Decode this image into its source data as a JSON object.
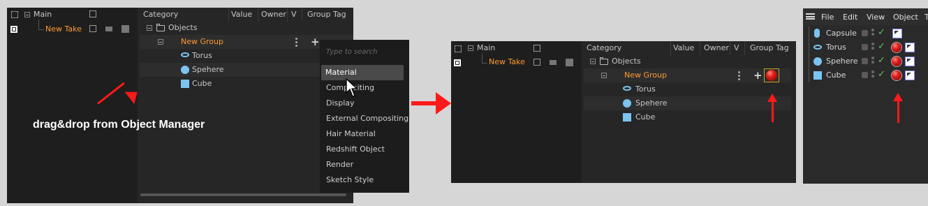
{
  "panel1": {
    "takes": {
      "main": "Main",
      "new_take": "New Take"
    },
    "headers": {
      "category": "Category",
      "value": "Value",
      "owner": "Owner",
      "v": "V",
      "group_tag": "Group Tag"
    },
    "tree": {
      "objects": "Objects",
      "new_group": "New Group",
      "torus": "Torus",
      "sphere": "Spehere",
      "cube": "Cube"
    },
    "annotation": "drag&drop from Object Manager",
    "dropdown": {
      "placeholder": "Type to search",
      "items": [
        "Material",
        "Compositing",
        "Display",
        "External Compositing",
        "Hair Material",
        "Redshift Object",
        "Render",
        "Sketch Style"
      ],
      "selected": "Material"
    }
  },
  "panel2": {
    "takes": {
      "main": "Main",
      "new_take": "New Take"
    },
    "headers": {
      "category": "Category",
      "value": "Value",
      "owner": "Owner",
      "v": "V",
      "group_tag": "Group Tag"
    },
    "tree": {
      "objects": "Objects",
      "new_group": "New Group",
      "torus": "Torus",
      "sphere": "Spehere",
      "cube": "Cube"
    }
  },
  "panel3": {
    "menu": [
      "File",
      "Edit",
      "View",
      "Object",
      "T"
    ],
    "objects": [
      "Capsule",
      "Torus",
      "Spehere",
      "Cube"
    ]
  },
  "colors": {
    "arrow": "#ff1a1a",
    "take_orange": "#ff9a33",
    "material_red": "#e02020",
    "check_green": "#5ccc5c"
  }
}
